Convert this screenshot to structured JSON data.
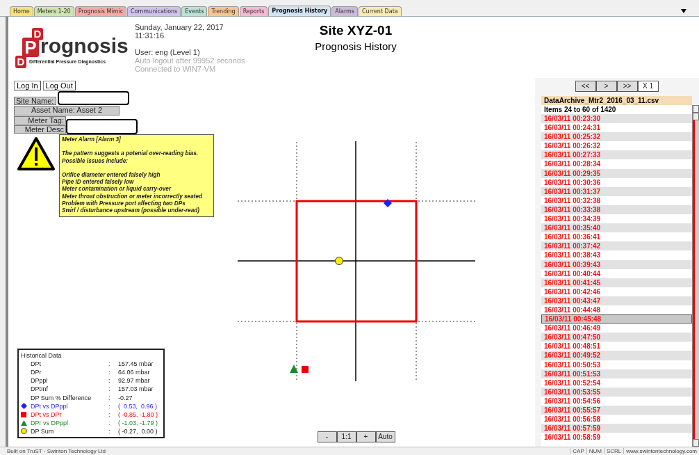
{
  "tabs": [
    {
      "label": "Home",
      "color": "#f7e27a",
      "selected": false
    },
    {
      "label": "Meters 1-20",
      "color": "#cfe4b0",
      "selected": false
    },
    {
      "label": "Prognosis Mimic",
      "color": "#f4aaa6",
      "selected": false
    },
    {
      "label": "Communications",
      "color": "#d0c2ec",
      "selected": false
    },
    {
      "label": "Events",
      "color": "#b9e2d4",
      "selected": false
    },
    {
      "label": "Trending",
      "color": "#f7c690",
      "selected": false
    },
    {
      "label": "Reports",
      "color": "#f3bad2",
      "selected": false
    },
    {
      "label": "Prognosis History",
      "color": "#d2e4f4",
      "selected": true
    },
    {
      "label": "Alarms",
      "color": "#cbbad9",
      "selected": false
    },
    {
      "label": "Current Data",
      "color": "#f8ecb3",
      "selected": false
    }
  ],
  "logo": {
    "mark_letters": [
      "D",
      "P",
      "D"
    ],
    "wordmark": "rognosis",
    "tagline": "Differential Pressure Diagnostics"
  },
  "header": {
    "date": "Sunday, January 22, 2017",
    "time": "11:31:16",
    "user": "User: eng (Level 1)",
    "logout_notice": "Auto logout after 99952 seconds",
    "connection": "Connected to WIN7-VM",
    "title": "Site XYZ-01",
    "subtitle": "Prognosis History"
  },
  "login_buttons": [
    "Log In",
    "Log Out"
  ],
  "info_fields": [
    {
      "label": "Site Name:",
      "redacted": true
    },
    {
      "label": "Asset Name:  Asset 2",
      "redacted": false
    },
    {
      "label": "Meter Tag:",
      "redacted": false
    },
    {
      "label": "Meter Desc",
      "redacted": true
    }
  ],
  "alarm": {
    "title": "Meter Alarm [Alarm 3]",
    "message": "The pattern suggests a potenial over-reading bias.",
    "issues_heading": "Possible issues include:",
    "issues": [
      "Orifice diameter entered falsely high",
      "Pipe ID entered falsely low",
      "Meter contamination or liquid carry-over",
      "Meter throat obstruction or meter incorrectly seated",
      "Problem with Pressure port affecting two DPs",
      "Swirl / disturbance upstream (possible under-read)"
    ]
  },
  "historical": {
    "title": "Historical Data",
    "rows": [
      {
        "label": "DPt",
        "separator": ":",
        "value": "157.45 mbar"
      },
      {
        "label": "DPr",
        "separator": ":",
        "value": "64.06 mbar"
      },
      {
        "label": "DPppl",
        "separator": ":",
        "value": "92.97 mbar"
      },
      {
        "label": "DPtInf",
        "separator": ":",
        "value": "157.03 mbar"
      },
      {
        "label": "DP Sum % Difference",
        "separator": ":",
        "value": "-0.27"
      },
      {
        "label": "DPt vs DPppl",
        "separator": ":",
        "value": "(  0.53,  0.96 )",
        "kind": "diamond",
        "color": "#1f1fff"
      },
      {
        "label": "DPt vs DPr",
        "separator": ":",
        "value": "( -0.85, -1.80 )",
        "kind": "square",
        "color": "#ff0000"
      },
      {
        "label": "DPr vs DPppl",
        "separator": ":",
        "value": "( -1.03, -1.79 )",
        "kind": "triangle",
        "color": "#1a8a2a"
      },
      {
        "label": "DP Sum",
        "separator": ":",
        "value": "( -0.27,  0.00 )",
        "kind": "circle",
        "color": "#ffee00"
      }
    ]
  },
  "zoom_buttons": [
    "-",
    "1:1",
    "+",
    "Auto"
  ],
  "nav_buttons": [
    "<<",
    ">",
    ">>",
    "X 1"
  ],
  "archive": {
    "file": "DataArchive_Mtr2_2016_03_11.csv",
    "range": "Items 24 to 60 of 1420",
    "items": [
      {
        "time": "16/03/11 00:23:30",
        "selected": false
      },
      {
        "time": "16/03/11 00:24:31",
        "selected": false
      },
      {
        "time": "16/03/11 00:25:32",
        "selected": false
      },
      {
        "time": "16/03/11 00:26:32",
        "selected": false
      },
      {
        "time": "16/03/11 00:27:33",
        "selected": false
      },
      {
        "time": "16/03/11 00:28:34",
        "selected": false
      },
      {
        "time": "16/03/11 00:29:35",
        "selected": false
      },
      {
        "time": "16/03/11 00:30:36",
        "selected": false
      },
      {
        "time": "16/03/11 00:31:37",
        "selected": false
      },
      {
        "time": "16/03/11 00:32:38",
        "selected": false
      },
      {
        "time": "16/03/11 00:33:38",
        "selected": false
      },
      {
        "time": "16/03/11 00:34:39",
        "selected": false
      },
      {
        "time": "16/03/11 00:35:40",
        "selected": false
      },
      {
        "time": "16/03/11 00:36:41",
        "selected": false
      },
      {
        "time": "16/03/11 00:37:42",
        "selected": false
      },
      {
        "time": "16/03/11 00:38:43",
        "selected": false
      },
      {
        "time": "16/03/11 00:39:43",
        "selected": false
      },
      {
        "time": "16/03/11 00:40:44",
        "selected": false
      },
      {
        "time": "16/03/11 00:41:45",
        "selected": false
      },
      {
        "time": "16/03/11 00:42:46",
        "selected": false
      },
      {
        "time": "16/03/11 00:43:47",
        "selected": false
      },
      {
        "time": "16/03/11 00:44:48",
        "selected": false
      },
      {
        "time": "16/03/11 00:45:48",
        "selected": true
      },
      {
        "time": "16/03/11 00:46:49",
        "selected": false
      },
      {
        "time": "16/03/11 00:47:50",
        "selected": false
      },
      {
        "time": "16/03/11 00:48:51",
        "selected": false
      },
      {
        "time": "16/03/11 00:49:52",
        "selected": false
      },
      {
        "time": "16/03/11 00:50:53",
        "selected": false
      },
      {
        "time": "16/03/11 00:51:53",
        "selected": false
      },
      {
        "time": "16/03/11 00:52:54",
        "selected": false
      },
      {
        "time": "16/03/11 00:53:55",
        "selected": false
      },
      {
        "time": "16/03/11 00:54:56",
        "selected": false
      },
      {
        "time": "16/03/11 00:55:57",
        "selected": false
      },
      {
        "time": "16/03/11 00:56:58",
        "selected": false
      },
      {
        "time": "16/03/11 00:57:59",
        "selected": false
      },
      {
        "time": "16/03/11 00:58:59",
        "selected": false
      }
    ]
  },
  "status_bar": {
    "credit": "Built on TruST - Swinton Technology Ltd",
    "indicators": [
      "CAP",
      "NUM",
      "SCRL"
    ],
    "website": "www.swintontechnology.com"
  }
}
